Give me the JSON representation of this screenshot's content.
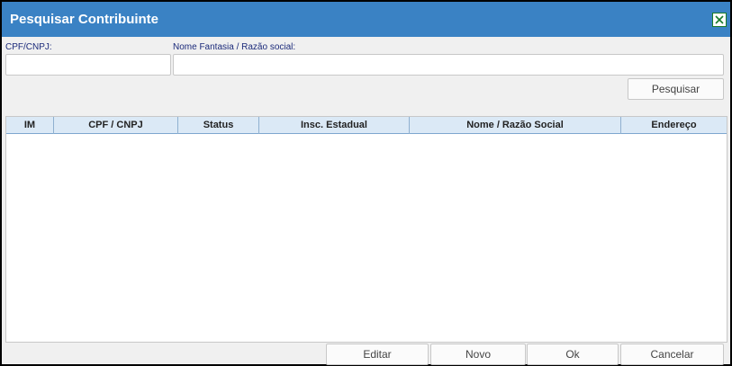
{
  "dialog": {
    "title": "Pesquisar Contribuinte",
    "close_icon": "close-icon"
  },
  "search": {
    "cpf_label": "CPF/CNPJ:",
    "cpf_value": "",
    "nome_label": "Nome Fantasia / Razão social:",
    "nome_value": "",
    "search_button": "Pesquisar"
  },
  "grid": {
    "columns": [
      "IM",
      "CPF / CNPJ",
      "Status",
      "Insc. Estadual",
      "Nome / Razão Social",
      "Endereço"
    ],
    "rows": []
  },
  "actions": {
    "edit": "Editar",
    "new": "Novo",
    "ok": "Ok",
    "cancel": "Cancelar"
  },
  "colors": {
    "titlebar": "#3a82c4",
    "header": "#dbe9f6",
    "label": "#1b2a7a"
  }
}
